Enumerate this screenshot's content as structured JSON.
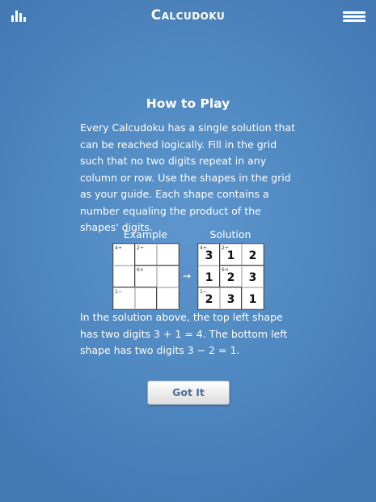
{
  "header": {
    "title": "Calcudoku",
    "stats_icon": "bar-chart-icon",
    "menu_icon": "hamburger-menu-icon"
  },
  "how_to_play": {
    "heading": "How to Play",
    "intro": "Every Calcudoku has a single solution that can be reached logically. Fill in the grid such that no two digits repeat in any column or row. Use the shapes in the grid as your guide. Each shape contains a number equaling the product of the shapes' digits.",
    "example_label": "Example",
    "solution_label": "Solution",
    "arrow": "→",
    "explanation": "In the solution above, the top left shape has two digits 3 + 1 = 4. The bottom left shape has two digits 3 − 2 = 1.",
    "button_label": "Got It"
  },
  "example_grid": {
    "clues": [
      "4+",
      "2÷",
      "6×",
      "1−"
    ],
    "solution": [
      [
        "3",
        "1",
        "2"
      ],
      [
        "1",
        "2",
        "3"
      ],
      [
        "2",
        "3",
        "1"
      ]
    ]
  },
  "colors": {
    "background": "#4f87c0",
    "button_text": "#4a6f98"
  }
}
